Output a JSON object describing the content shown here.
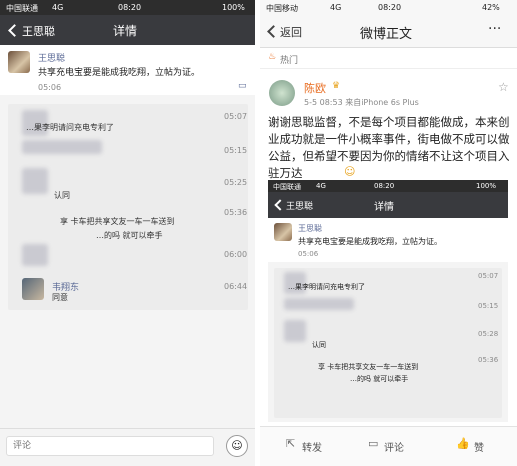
{
  "left": {
    "status": {
      "carrier": "中国联通",
      "network": "4G",
      "time": "08:20",
      "battery": "100%"
    },
    "nav": {
      "back_label": "王思聪",
      "title": "详情"
    },
    "post": {
      "author": "王思聪",
      "text": "共享充电宝要是能成我吃翔，立帖为证。",
      "time": "05:06"
    },
    "comments": [
      {
        "text": "…果李明请问充电专利了",
        "time": "05:07"
      },
      {
        "text": "",
        "time": "05:15"
      },
      {
        "text": "认同",
        "time": "05:25"
      },
      {
        "text": "享 卡车把共享文友一车一车送到",
        "time": "05:36"
      },
      {
        "text": "…的吗 就可以牵手",
        "time": ""
      },
      {
        "text": "",
        "time": "06:00"
      }
    ],
    "last_comment": {
      "author": "韦翔东",
      "text": "同意",
      "time": "06:44"
    },
    "input": {
      "placeholder": "评论"
    }
  },
  "right": {
    "status": {
      "carrier": "中国移动",
      "network": "4G",
      "time": "08:20",
      "battery": "42%"
    },
    "nav": {
      "back_label": "返回",
      "title": "微博正文",
      "more": "···"
    },
    "hot_label": "热门",
    "weibo": {
      "author": "陈欧",
      "meta": "5-5 08:53 来自iPhone 6s Plus",
      "text": "谢谢思聪监督，不是每个项目都能做成，本来创业成功就是一件小概率事件，街电做不成可以做公益，但希望不要因为你的情绪不让这个项目入驻万达"
    },
    "embedded": {
      "status": {
        "carrier": "中国联通",
        "network": "4G",
        "time": "08:20",
        "battery": "100%"
      },
      "nav": {
        "back_label": "王思聪",
        "title": "详情"
      },
      "post": {
        "author": "王思聪",
        "text": "共享充电宝要是能成我吃翔，立帖为证。",
        "time": "05:06"
      },
      "comments": [
        {
          "text": "…果李明请问充电专利了",
          "time": "05:07"
        },
        {
          "text": "",
          "time": "05:15"
        },
        {
          "text": "认同",
          "time": "05:28"
        },
        {
          "text": "享 卡车把共享文友一车一车送到",
          "time": "05:36"
        },
        {
          "text": "…的吗 就可以牵手",
          "time": ""
        }
      ]
    },
    "toolbar": {
      "repost": "转发",
      "comment": "评论",
      "like": "赞"
    }
  }
}
